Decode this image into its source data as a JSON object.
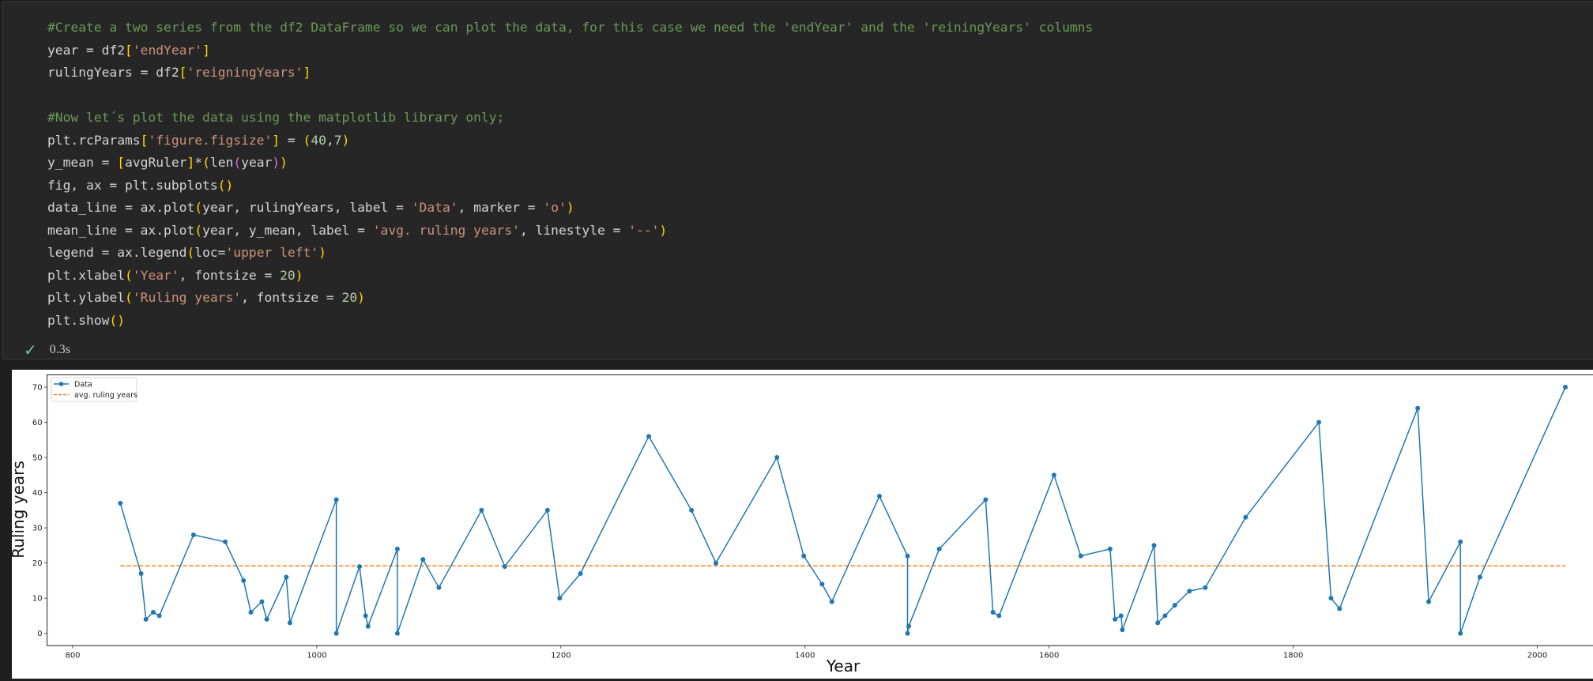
{
  "cell": {
    "code_lines": [
      [
        {
          "t": "#Create a two series from the df2 DataFrame so we can plot the data, for this case we need the 'endYear' and the 'reiningYears' columns",
          "k": "c"
        }
      ],
      [
        {
          "t": "year = df2",
          "k": "t"
        },
        {
          "t": "[",
          "k": "b"
        },
        {
          "t": "'endYear'",
          "k": "s"
        },
        {
          "t": "]",
          "k": "b"
        }
      ],
      [
        {
          "t": "rulingYears = df2",
          "k": "t"
        },
        {
          "t": "[",
          "k": "b"
        },
        {
          "t": "'reigningYears'",
          "k": "s"
        },
        {
          "t": "]",
          "k": "b"
        }
      ],
      [],
      [
        {
          "t": "#Now let´s plot the data using the matplotlib library only;",
          "k": "c"
        }
      ],
      [
        {
          "t": "plt.rcParams",
          "k": "t"
        },
        {
          "t": "[",
          "k": "b"
        },
        {
          "t": "'figure.figsize'",
          "k": "s"
        },
        {
          "t": "]",
          "k": "b"
        },
        {
          "t": " = ",
          "k": "t"
        },
        {
          "t": "(",
          "k": "b"
        },
        {
          "t": "40",
          "k": "n"
        },
        {
          "t": ",",
          "k": "t"
        },
        {
          "t": "7",
          "k": "n"
        },
        {
          "t": ")",
          "k": "b"
        }
      ],
      [
        {
          "t": "y_mean = ",
          "k": "t"
        },
        {
          "t": "[",
          "k": "b"
        },
        {
          "t": "avgRuler",
          "k": "t"
        },
        {
          "t": "]",
          "k": "b"
        },
        {
          "t": "*",
          "k": "t"
        },
        {
          "t": "(",
          "k": "b"
        },
        {
          "t": "len",
          "k": "t"
        },
        {
          "t": "(",
          "k": "p"
        },
        {
          "t": "year",
          "k": "t"
        },
        {
          "t": ")",
          "k": "p"
        },
        {
          "t": ")",
          "k": "b"
        }
      ],
      [
        {
          "t": "fig, ax = plt.subplots",
          "k": "t"
        },
        {
          "t": "()",
          "k": "b"
        }
      ],
      [
        {
          "t": "data_line = ax.plot",
          "k": "t"
        },
        {
          "t": "(",
          "k": "b"
        },
        {
          "t": "year, rulingYears, label = ",
          "k": "t"
        },
        {
          "t": "'Data'",
          "k": "s"
        },
        {
          "t": ", marker = ",
          "k": "t"
        },
        {
          "t": "'o'",
          "k": "s"
        },
        {
          "t": ")",
          "k": "b"
        }
      ],
      [
        {
          "t": "mean_line = ax.plot",
          "k": "t"
        },
        {
          "t": "(",
          "k": "b"
        },
        {
          "t": "year, y_mean, label = ",
          "k": "t"
        },
        {
          "t": "'avg. ruling years'",
          "k": "s"
        },
        {
          "t": ", linestyle = ",
          "k": "t"
        },
        {
          "t": "'--'",
          "k": "s"
        },
        {
          "t": ")",
          "k": "b"
        }
      ],
      [
        {
          "t": "legend = ax.legend",
          "k": "t"
        },
        {
          "t": "(",
          "k": "b"
        },
        {
          "t": "loc=",
          "k": "t"
        },
        {
          "t": "'upper left'",
          "k": "s"
        },
        {
          "t": ")",
          "k": "b"
        }
      ],
      [
        {
          "t": "plt.xlabel",
          "k": "t"
        },
        {
          "t": "(",
          "k": "b"
        },
        {
          "t": "'Year'",
          "k": "s"
        },
        {
          "t": ", fontsize = ",
          "k": "t"
        },
        {
          "t": "20",
          "k": "n"
        },
        {
          "t": ")",
          "k": "b"
        }
      ],
      [
        {
          "t": "plt.ylabel",
          "k": "t"
        },
        {
          "t": "(",
          "k": "b"
        },
        {
          "t": "'Ruling years'",
          "k": "s"
        },
        {
          "t": ", fontsize = ",
          "k": "t"
        },
        {
          "t": "20",
          "k": "n"
        },
        {
          "t": ")",
          "k": "b"
        }
      ],
      [
        {
          "t": "plt.show",
          "k": "t"
        },
        {
          "t": "()",
          "k": "b"
        }
      ]
    ],
    "status_icon": "check-icon",
    "status_mark": "✓",
    "exec_time": "0.3s"
  },
  "colors": {
    "data": "#1f77b4",
    "mean": "#ff7f0e"
  },
  "chart_data": {
    "type": "line",
    "title": "",
    "xlabel": "Year",
    "ylabel": "Ruling years",
    "xlim": [
      779,
      2083
    ],
    "ylim": [
      -3.5,
      73.5
    ],
    "xticks": [
      800,
      1000,
      1200,
      1400,
      1600,
      1800,
      2000
    ],
    "yticks": [
      0,
      10,
      20,
      30,
      40,
      50,
      60,
      70
    ],
    "grid": false,
    "legend": {
      "placement": "upper-left",
      "entries": [
        "Data",
        "avg. ruling years"
      ]
    },
    "series": [
      {
        "name": "Data",
        "marker": "o",
        "linestyle": "solid",
        "x": [
          839,
          856,
          860,
          866,
          871,
          899,
          925,
          940,
          946,
          955,
          959,
          975,
          978,
          1016,
          1016,
          1035,
          1040,
          1042,
          1066,
          1066,
          1087,
          1100,
          1135,
          1154,
          1189,
          1199,
          1216,
          1272,
          1307,
          1327,
          1377,
          1399,
          1414,
          1422,
          1461,
          1484,
          1484,
          1485,
          1510,
          1548,
          1554,
          1559,
          1604,
          1626,
          1650,
          1654,
          1659,
          1660,
          1686,
          1689,
          1695,
          1703,
          1715,
          1728,
          1761,
          1821,
          1831,
          1838,
          1902,
          1911,
          1937,
          1937,
          1953,
          2023
        ],
        "y": [
          37,
          17,
          4,
          6,
          5,
          28,
          26,
          15,
          6,
          9,
          4,
          16,
          3,
          38,
          0,
          19,
          5,
          2,
          24,
          0,
          21,
          13,
          35,
          19,
          35,
          10,
          17,
          56,
          35,
          20,
          50,
          22,
          14,
          9,
          39,
          22,
          0,
          2,
          24,
          38,
          6,
          5,
          45,
          22,
          24,
          4,
          5,
          1,
          25,
          3,
          5,
          8,
          12,
          13,
          33,
          60,
          10,
          7,
          64,
          9,
          26,
          0,
          16,
          70
        ]
      },
      {
        "name": "avg. ruling years",
        "linestyle": "dashed",
        "x": [
          839,
          2023
        ],
        "y": [
          19.2,
          19.2
        ]
      }
    ]
  }
}
